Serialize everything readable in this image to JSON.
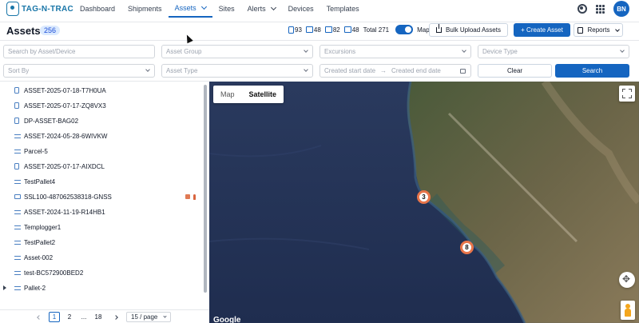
{
  "app": {
    "logo_text": "TAG-N-TRAC"
  },
  "nav": {
    "items": [
      {
        "label": "Dashboard",
        "active": false,
        "dropdown": false
      },
      {
        "label": "Shipments",
        "active": false,
        "dropdown": false
      },
      {
        "label": "Assets",
        "active": true,
        "dropdown": true
      },
      {
        "label": "Sites",
        "active": false,
        "dropdown": false
      },
      {
        "label": "Alerts",
        "active": false,
        "dropdown": true
      },
      {
        "label": "Devices",
        "active": false,
        "dropdown": false
      },
      {
        "label": "Templates",
        "active": false,
        "dropdown": false
      }
    ],
    "user_initials": "BN",
    "icons": [
      "gear-icon",
      "apps-grid-icon"
    ]
  },
  "header": {
    "title": "Assets",
    "count": "256",
    "stats": [
      "93",
      "48",
      "82",
      "48"
    ],
    "total_label": "Total 271",
    "map_toggle_label": "Map",
    "map_toggle_on": true,
    "bulk_upload_label": "Bulk Upload Assets",
    "create_label": "+ Create Asset",
    "reports_label": "Reports"
  },
  "filters": {
    "search_placeholder": "Search by Asset/Device",
    "asset_group_placeholder": "Asset Group",
    "excursions_placeholder": "Excursions",
    "device_type_placeholder": "Device Type",
    "sort_by_placeholder": "Sort By",
    "asset_type_placeholder": "Asset Type",
    "start_date_placeholder": "Created start date",
    "end_date_placeholder": "Created end date",
    "clear_label": "Clear",
    "search_label": "Search"
  },
  "list": {
    "items": [
      {
        "label": "ASSET-2025-07-18-T7H0UA",
        "icon": "tracker-icon"
      },
      {
        "label": "ASSET-2025-07-17-ZQ8VX3",
        "icon": "tracker-icon"
      },
      {
        "label": "DP-ASSET-BAG02",
        "icon": "tracker-icon"
      },
      {
        "label": "ASSET-2024-05-28-6WIVKW",
        "icon": "pallet-icon"
      },
      {
        "label": "Parcel-5",
        "icon": "pallet-icon"
      },
      {
        "label": "ASSET-2025-07-17-AIXDCL",
        "icon": "tracker-icon"
      },
      {
        "label": "TestPallet4",
        "icon": "pallet-icon"
      },
      {
        "label": "SSL100-487062538318-GNSS",
        "icon": "sensor-icon",
        "alerts": true
      },
      {
        "label": "ASSET-2024-11-19-R14HB1",
        "icon": "pallet-icon"
      },
      {
        "label": "Templogger1",
        "icon": "pallet-icon"
      },
      {
        "label": "TestPallet2",
        "icon": "pallet-icon"
      },
      {
        "label": "Asset-002",
        "icon": "pallet-icon"
      },
      {
        "label": "test-BC572900BED2",
        "icon": "pallet-icon"
      },
      {
        "label": "Pallet-2",
        "icon": "pallet-icon",
        "expandable": true
      }
    ]
  },
  "pagination": {
    "current": "1",
    "pages": [
      "1",
      "2",
      "...",
      "18"
    ],
    "per_page": "15 / page"
  },
  "map": {
    "tabs": [
      "Map",
      "Satellite"
    ],
    "active_tab": "Satellite",
    "clusters": [
      "3",
      "8"
    ],
    "attribution": "Google",
    "cluster_color": "#e8754a"
  },
  "colors": {
    "primary": "#1565c0",
    "accent_orange": "#e8754a"
  }
}
